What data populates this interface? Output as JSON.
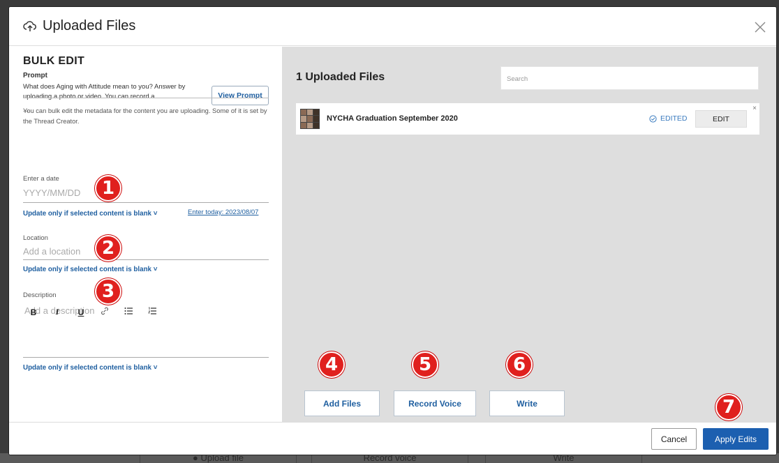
{
  "header": {
    "title": "Uploaded Files"
  },
  "bulk_edit": {
    "title": "BULK EDIT",
    "prompt_label": "Prompt",
    "prompt_text": "What does Aging with Attitude mean to you? Answer by uploading a photo or video. You can record a",
    "prompt_ellipsis": "...",
    "view_prompt_label": "View Prompt",
    "info": "You can bulk edit the metadata for the content you are uploading. Some of it is set by the Thread Creator.",
    "date": {
      "label": "Enter a date",
      "placeholder": "YYYY/MM/DD",
      "blank_option": "Update only if selected content is blank",
      "today_link": "Enter today: 2023/08/07"
    },
    "location": {
      "label": "Location",
      "placeholder": "Add a location",
      "blank_option": "Update only if selected content is blank"
    },
    "description": {
      "label": "Description",
      "placeholder": "Add a description",
      "blank_option": "Update only if selected content is blank"
    },
    "toolbar": {
      "bold": "B",
      "italic": "I",
      "underline": "U"
    }
  },
  "files": {
    "count_label": "1 Uploaded Files",
    "search_placeholder": "Search",
    "items": [
      {
        "name": "NYCHA Graduation September 2020",
        "status": "EDITED",
        "edit_label": "EDIT",
        "remove": "×"
      }
    ]
  },
  "actions": {
    "add_files": "Add Files",
    "record_voice": "Record Voice",
    "write": "Write"
  },
  "footer": {
    "cancel": "Cancel",
    "apply": "Apply Edits"
  },
  "markers": [
    "1",
    "2",
    "3",
    "4",
    "5",
    "6",
    "7"
  ],
  "background_buttons": {
    "upload": "Upload file",
    "record": "Record voice",
    "write": "Write"
  },
  "colors": {
    "accent": "#1c5fb0",
    "marker": "#e0201e",
    "link": "#1f5fa0"
  }
}
